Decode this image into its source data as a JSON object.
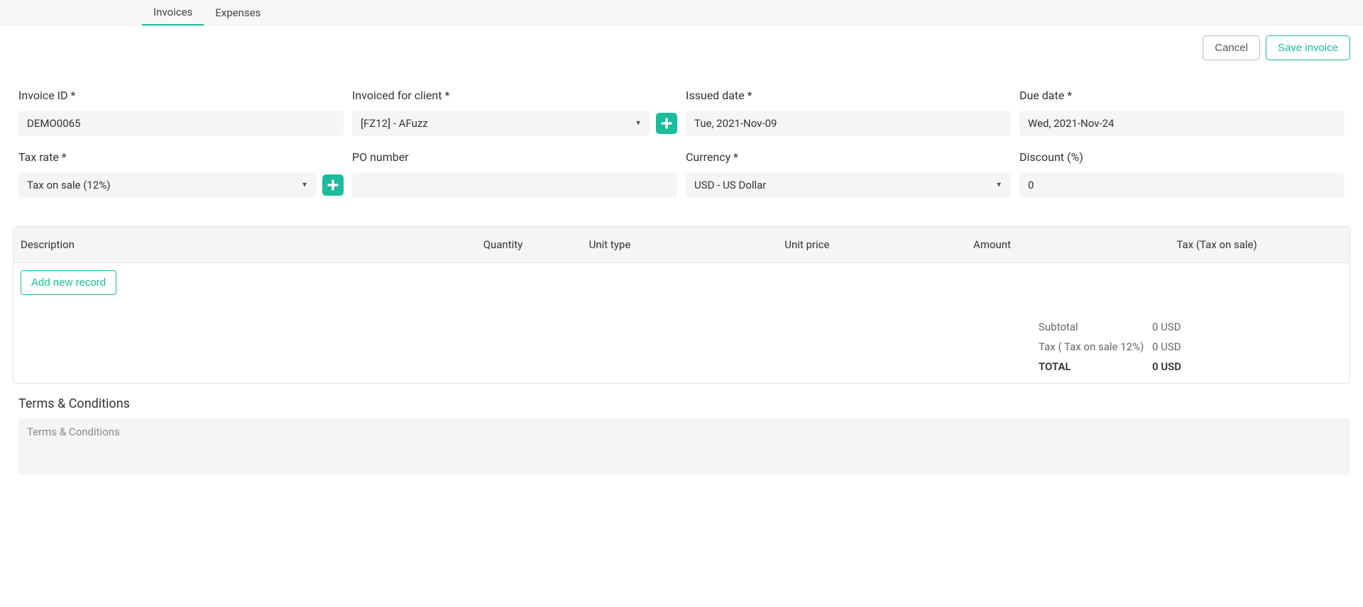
{
  "nav": {
    "tabs": [
      "Invoices",
      "Expenses"
    ],
    "active": 0
  },
  "actions": {
    "cancel": "Cancel",
    "save": "Save invoice"
  },
  "fields": {
    "invoice_id": {
      "label": "Invoice ID *",
      "value": "DEMO0065"
    },
    "client": {
      "label": "Invoiced for client *",
      "value": "[FZ12] - AFuzz"
    },
    "issued": {
      "label": "Issued date *",
      "value": "Tue, 2021-Nov-09"
    },
    "due": {
      "label": "Due date *",
      "value": "Wed, 2021-Nov-24"
    },
    "tax_rate": {
      "label": "Tax rate *",
      "value": "Tax on sale (12%)"
    },
    "po": {
      "label": "PO number",
      "value": ""
    },
    "currency": {
      "label": "Currency *",
      "value": "USD - US Dollar"
    },
    "discount": {
      "label": "Discount (%)",
      "value": "0"
    }
  },
  "table": {
    "headers": {
      "description": "Description",
      "quantity": "Quantity",
      "unit_type": "Unit type",
      "unit_price": "Unit price",
      "amount": "Amount",
      "tax": "Tax (Tax on sale)"
    },
    "add_record": "Add new record"
  },
  "totals": {
    "subtotal_label": "Subtotal",
    "subtotal_value": "0 USD",
    "tax_label": "Tax ( Tax on sale 12%)",
    "tax_value": "0 USD",
    "total_label": "TOTAL",
    "total_value": "0 USD"
  },
  "terms": {
    "heading": "Terms & Conditions",
    "placeholder": "Terms & Conditions",
    "value": ""
  }
}
